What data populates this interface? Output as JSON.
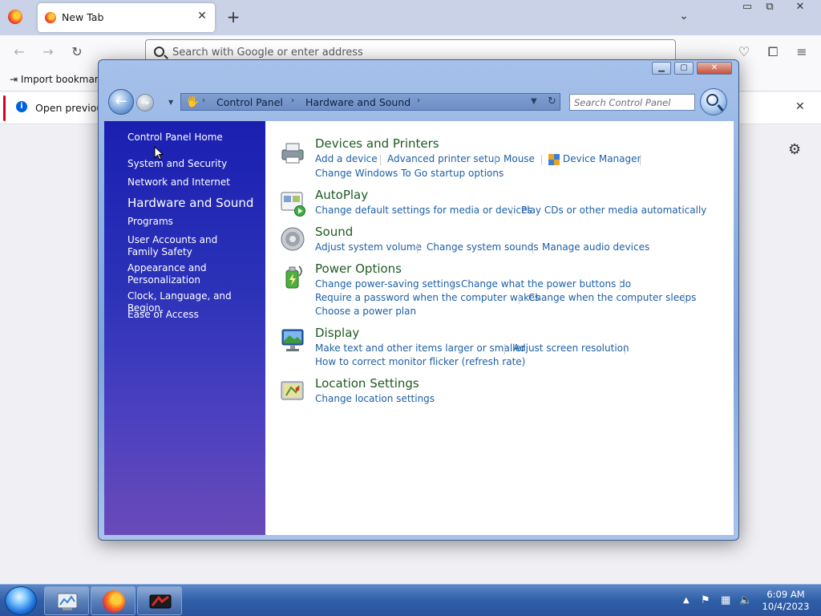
{
  "browser": {
    "tab_title": "New Tab",
    "url_placeholder": "Search with Google or enter address",
    "bookmark_item": "Import bookmark",
    "notice_text": "Open previous"
  },
  "control_panel": {
    "breadcrumb": [
      "Control Panel",
      "Hardware and Sound"
    ],
    "search_placeholder": "Search Control Panel",
    "sidebar": {
      "home": "Control Panel Home",
      "items": [
        "System and Security",
        "Network and Internet",
        "Hardware and Sound",
        "Programs",
        "User Accounts and Family Safety",
        "Appearance and Personalization",
        "Clock, Language, and Region",
        "Ease of Access"
      ]
    },
    "categories": [
      {
        "title": "Devices and Printers",
        "tasks": [
          "Add a device",
          "Advanced printer setup",
          "Mouse",
          "Device Manager",
          "Change Windows To Go startup options"
        ]
      },
      {
        "title": "AutoPlay",
        "tasks": [
          "Change default settings for media or devices",
          "Play CDs or other media automatically"
        ]
      },
      {
        "title": "Sound",
        "tasks": [
          "Adjust system volume",
          "Change system sounds",
          "Manage audio devices"
        ]
      },
      {
        "title": "Power Options",
        "tasks": [
          "Change power-saving settings",
          "Change what the power buttons do",
          "Require a password when the computer wakes",
          "Change when the computer sleeps",
          "Choose a power plan"
        ]
      },
      {
        "title": "Display",
        "tasks": [
          "Make text and other items larger or smaller",
          "Adjust screen resolution",
          "How to correct monitor flicker (refresh rate)"
        ]
      },
      {
        "title": "Location Settings",
        "tasks": [
          "Change location settings"
        ]
      }
    ]
  },
  "taskbar": {
    "time": "6:09 AM",
    "date": "10/4/2023"
  },
  "colors": {
    "sidebar_top": "#1a1fb0",
    "link": "#1c5fa6",
    "category_title": "#1e5a22",
    "taskbar": "#2f5fa8"
  }
}
